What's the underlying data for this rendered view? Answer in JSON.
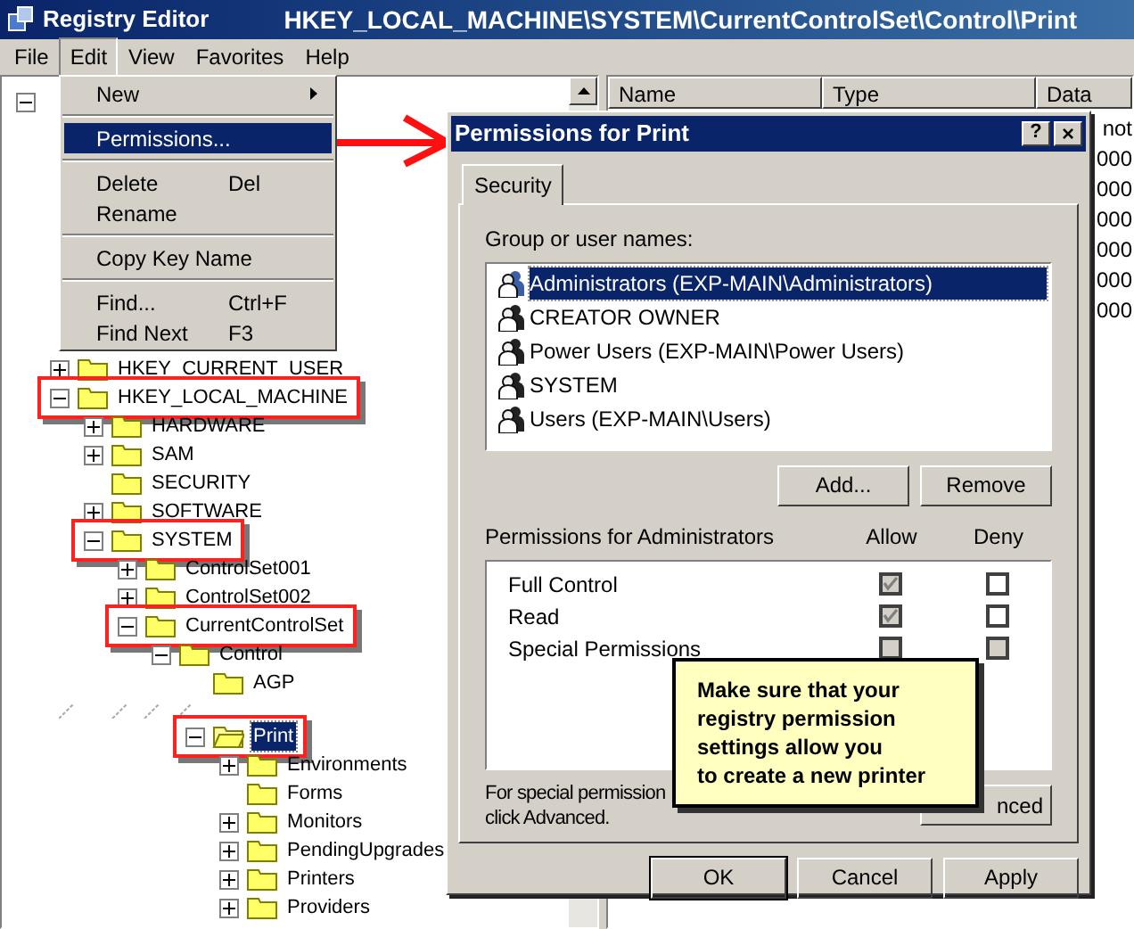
{
  "window": {
    "title": "Registry Editor",
    "path": "HKEY_LOCAL_MACHINE\\SYSTEM\\CurrentControlSet\\Control\\Print"
  },
  "menu_bar": [
    {
      "label": "File",
      "selected": false
    },
    {
      "label": "Edit",
      "selected": true
    },
    {
      "label": "View",
      "selected": false
    },
    {
      "label": "Favorites",
      "selected": false
    },
    {
      "label": "Help",
      "selected": false
    }
  ],
  "edit_menu": [
    {
      "kind": "item",
      "label": "New",
      "submenu": true,
      "selected": false
    },
    {
      "kind": "separator"
    },
    {
      "kind": "item",
      "label": "Permissions...",
      "selected": true
    },
    {
      "kind": "separator"
    },
    {
      "kind": "item",
      "label": "Delete",
      "shortcut": "Del",
      "selected": false
    },
    {
      "kind": "item",
      "label": "Rename",
      "selected": false
    },
    {
      "kind": "separator"
    },
    {
      "kind": "item",
      "label": "Copy Key Name",
      "selected": false
    },
    {
      "kind": "separator"
    },
    {
      "kind": "item",
      "label": "Find...",
      "shortcut": "Ctrl+F",
      "selected": false
    },
    {
      "kind": "item",
      "label": "Find Next",
      "shortcut": "F3",
      "selected": false
    }
  ],
  "tree": [
    {
      "kind": "root",
      "expanded": true,
      "children": [
        {
          "label": "HKEY_CURRENT_USER",
          "expandable": true,
          "expanded": false,
          "highlighted": false,
          "selected": false
        },
        {
          "label": "HKEY_LOCAL_MACHINE",
          "expandable": true,
          "expanded": true,
          "highlighted": true,
          "selected": false,
          "children": [
            {
              "label": "HARDWARE",
              "expandable": true,
              "expanded": false,
              "highlighted": false,
              "selected": false
            },
            {
              "label": "SAM",
              "expandable": true,
              "expanded": false,
              "highlighted": false,
              "selected": false
            },
            {
              "label": "SECURITY",
              "expandable": false,
              "highlighted": false,
              "selected": false
            },
            {
              "label": "SOFTWARE",
              "expandable": true,
              "expanded": false,
              "highlighted": false,
              "selected": false
            },
            {
              "label": "SYSTEM",
              "expandable": true,
              "expanded": true,
              "highlighted": true,
              "selected": false,
              "children": [
                {
                  "label": "ControlSet001",
                  "expandable": true,
                  "expanded": false,
                  "highlighted": false,
                  "selected": false
                },
                {
                  "label": "ControlSet002",
                  "expandable": true,
                  "expanded": false,
                  "highlighted": false,
                  "selected": false
                },
                {
                  "label": "CurrentControlSet",
                  "expandable": true,
                  "expanded": true,
                  "highlighted": true,
                  "selected": false,
                  "children": [
                    {
                      "label": "Control",
                      "expandable": true,
                      "expanded": true,
                      "highlighted": false,
                      "selected": false,
                      "children": [
                        {
                          "label": "AGP",
                          "expandable": false,
                          "highlighted": false,
                          "selected": false
                        },
                        {
                          "kind": "gap"
                        },
                        {
                          "label": "Print",
                          "expandable": true,
                          "expanded": true,
                          "highlighted": true,
                          "selected": true,
                          "children": [
                            {
                              "label": "Environments",
                              "expandable": true,
                              "expanded": false,
                              "highlighted": false,
                              "selected": false
                            },
                            {
                              "label": "Forms",
                              "expandable": false,
                              "highlighted": false,
                              "selected": false
                            },
                            {
                              "label": "Monitors",
                              "expandable": true,
                              "expanded": false,
                              "highlighted": false,
                              "selected": false
                            },
                            {
                              "label": "PendingUpgrades",
                              "expandable": true,
                              "expanded": false,
                              "highlighted": false,
                              "selected": false
                            },
                            {
                              "label": "Printers",
                              "expandable": true,
                              "expanded": false,
                              "highlighted": false,
                              "selected": false
                            },
                            {
                              "label": "Providers",
                              "expandable": true,
                              "expanded": false,
                              "highlighted": false,
                              "selected": false
                            }
                          ]
                        }
                      ]
                    }
                  ]
                }
              ]
            }
          ]
        }
      ]
    }
  ],
  "values": {
    "columns": [
      "Name",
      "Type",
      "Data"
    ],
    "data_cells": [
      "not",
      "000",
      "000",
      "000",
      "000",
      "000",
      "000"
    ]
  },
  "dialog": {
    "title": "Permissions for Print",
    "help": "?",
    "close": "×",
    "tabs": [
      {
        "label": "Security",
        "selected": true
      }
    ],
    "group_label": "Group or user names:",
    "users": [
      {
        "name": "Administrators (EXP-MAIN\\Administrators)",
        "selected": true
      },
      {
        "name": "CREATOR OWNER",
        "selected": false
      },
      {
        "name": "Power Users (EXP-MAIN\\Power Users)",
        "selected": false
      },
      {
        "name": "SYSTEM",
        "selected": false
      },
      {
        "name": "Users (EXP-MAIN\\Users)",
        "selected": false
      }
    ],
    "add_button": "Add...",
    "remove_button": "Remove",
    "permissions_label": "Permissions for Administrators",
    "allow_label": "Allow",
    "deny_label": "Deny",
    "permissions": [
      {
        "name": "Full Control",
        "allow": {
          "checked": true,
          "disabled": true
        },
        "deny": {
          "checked": false,
          "disabled": false
        }
      },
      {
        "name": "Read",
        "allow": {
          "checked": true,
          "disabled": true
        },
        "deny": {
          "checked": false,
          "disabled": false
        }
      },
      {
        "name": "Special Permissions",
        "allow": {
          "checked": false,
          "disabled": true
        },
        "deny": {
          "checked": false,
          "disabled": true
        }
      }
    ],
    "note_lines": [
      "For special permission",
      "click Advanced."
    ],
    "advanced_button": "nced",
    "buttons": [
      "OK",
      "Cancel",
      "Apply"
    ]
  },
  "callout": {
    "lines": [
      "Make sure that your",
      "registry permission",
      "settings allow you",
      "to create a new printer"
    ]
  }
}
